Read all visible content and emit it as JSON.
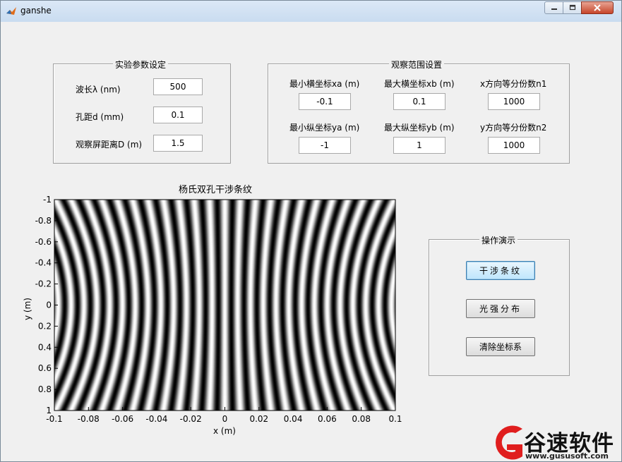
{
  "window": {
    "title": "ganshe"
  },
  "params_panel": {
    "title": "实验参数设定",
    "rows": [
      {
        "label": "波长λ (nm)",
        "value": "500"
      },
      {
        "label": "孔距d (mm)",
        "value": "0.1"
      },
      {
        "label": "观察屏距离D (m)",
        "value": "1.5"
      }
    ]
  },
  "range_panel": {
    "title": "观察范围设置",
    "fields": [
      {
        "label": "最小横坐标xa (m)",
        "value": "-0.1"
      },
      {
        "label": "最大横坐标xb (m)",
        "value": "0.1"
      },
      {
        "label": "x方向等分份数n1",
        "value": "1000"
      },
      {
        "label": "最小纵坐标ya (m)",
        "value": "-1"
      },
      {
        "label": "最大纵坐标yb (m)",
        "value": "1"
      },
      {
        "label": "y方向等分份数n2",
        "value": "1000"
      }
    ]
  },
  "ops_panel": {
    "title": "操作演示",
    "buttons": [
      "干涉条纹",
      "光强分布",
      "清除坐标系"
    ]
  },
  "plot": {
    "title": "杨氏双孔干涉条纹",
    "xlabel": "x (m)",
    "ylabel": "y (m)",
    "xticks": [
      "-0.1",
      "-0.08",
      "-0.06",
      "-0.04",
      "-0.02",
      "0",
      "0.02",
      "0.04",
      "0.06",
      "0.08",
      "0.1"
    ],
    "yticks": [
      "-1",
      "-0.8",
      "-0.6",
      "-0.4",
      "-0.2",
      "0",
      "0.2",
      "0.4",
      "0.6",
      "0.8",
      "1"
    ]
  },
  "chart_data": {
    "type": "heatmap",
    "title": "杨氏双孔干涉条纹",
    "xlabel": "x (m)",
    "ylabel": "y (m)",
    "xlim": [
      -0.1,
      0.1
    ],
    "ylim": [
      -1,
      1
    ],
    "y_reversed": true,
    "colormap": "gray",
    "wavelength_nm": 500,
    "hole_distance_mm": 0.1,
    "screen_distance_m": 1.5
  },
  "watermark": {
    "text": "谷速软件",
    "url": "www.gususoft.com"
  }
}
